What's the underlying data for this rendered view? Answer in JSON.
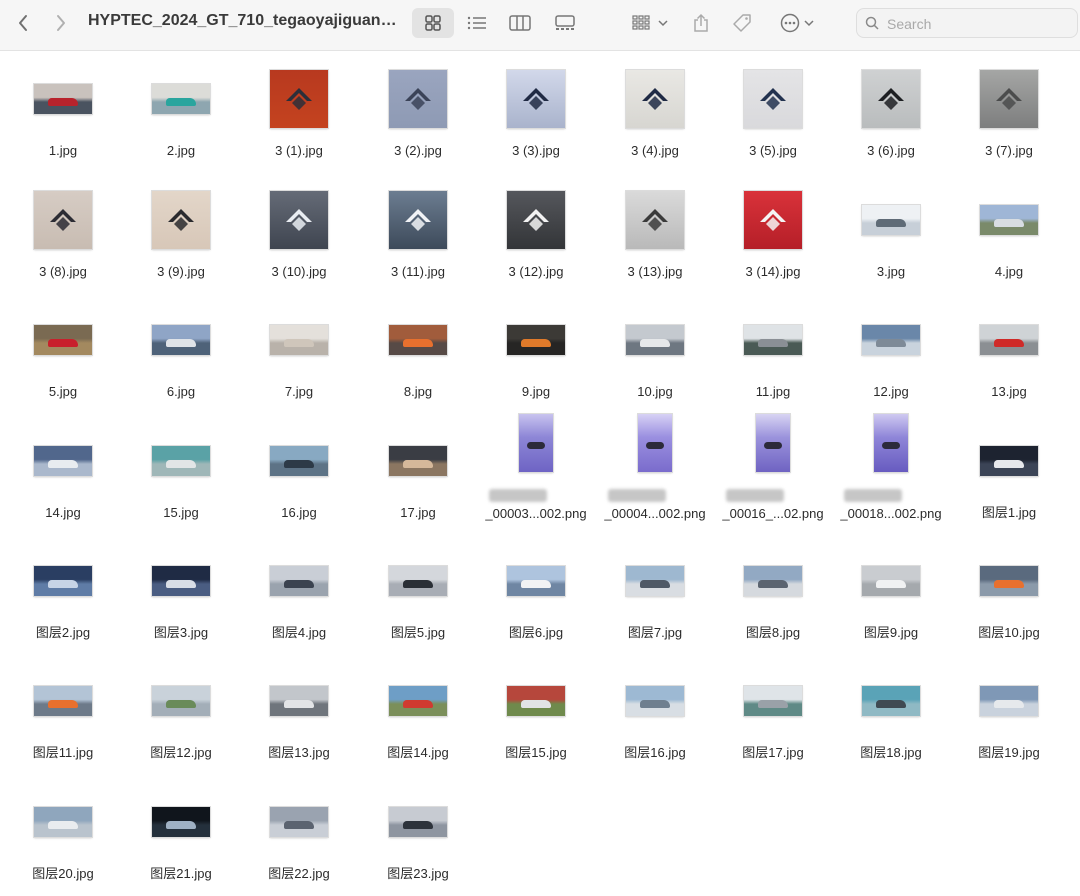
{
  "window": {
    "title": "HYPTEC_2024_GT_710_tegaoyajiguan…",
    "back_icon": "chevron-left-icon",
    "forward_icon": "chevron-right-icon"
  },
  "toolbar": {
    "view_modes": [
      "icon-view-icon",
      "list-view-icon",
      "column-view-icon",
      "gallery-view-icon"
    ],
    "selected_view": "icon-view-icon",
    "group_icon": "group-by-icon",
    "share_icon": "share-icon",
    "tag_icon": "tag-icon",
    "more_icon": "ellipsis-circle-icon"
  },
  "search": {
    "placeholder": "Search",
    "value": ""
  },
  "files": [
    {
      "name": "1.jpg",
      "kind": "landscape",
      "colors": [
        "#c9c2bd",
        "#4a5360",
        "#b8232c"
      ]
    },
    {
      "name": "2.jpg",
      "kind": "landscape",
      "colors": [
        "#dcdcd8",
        "#8ea6b0",
        "#2aa59e"
      ]
    },
    {
      "name": "3 (1).jpg",
      "kind": "square",
      "colors": [
        "#b8391f",
        "#c4431f",
        "#2b2f3a"
      ]
    },
    {
      "name": "3 (2).jpg",
      "kind": "square",
      "colors": [
        "#9aa5bf",
        "#8e9ab4",
        "#3b4358"
      ]
    },
    {
      "name": "3 (3).jpg",
      "kind": "square",
      "colors": [
        "#d2d8ea",
        "#a9b3cc",
        "#202a44"
      ]
    },
    {
      "name": "3 (4).jpg",
      "kind": "square",
      "colors": [
        "#e9e8e4",
        "#d7d6d1",
        "#1f2a44"
      ]
    },
    {
      "name": "3 (5).jpg",
      "kind": "square",
      "colors": [
        "#e4e4e6",
        "#d9d9dc",
        "#23324f"
      ]
    },
    {
      "name": "3 (6).jpg",
      "kind": "square",
      "colors": [
        "#cfd1d2",
        "#b9bcbd",
        "#1d1f22"
      ]
    },
    {
      "name": "3 (7).jpg",
      "kind": "square",
      "colors": [
        "#a5a6a5",
        "#7d7e7e",
        "#4b4c4c"
      ]
    },
    {
      "name": "3 (8).jpg",
      "kind": "square",
      "colors": [
        "#d6ccc4",
        "#c8bcb2",
        "#2c2c34"
      ]
    },
    {
      "name": "3 (9).jpg",
      "kind": "square",
      "colors": [
        "#e3d6c9",
        "#d7c7b8",
        "#2a2a2e"
      ]
    },
    {
      "name": "3 (10).jpg",
      "kind": "square",
      "colors": [
        "#656b77",
        "#3f4550",
        "#e9edf2"
      ]
    },
    {
      "name": "3 (11).jpg",
      "kind": "square",
      "colors": [
        "#6c7d91",
        "#3d4a5a",
        "#f1f3f6"
      ]
    },
    {
      "name": "3 (12).jpg",
      "kind": "square",
      "colors": [
        "#55575c",
        "#333538",
        "#f2f2f2"
      ]
    },
    {
      "name": "3 (13).jpg",
      "kind": "square",
      "colors": [
        "#dadada",
        "#b9b9b9",
        "#3b3b3b"
      ]
    },
    {
      "name": "3 (14).jpg",
      "kind": "square",
      "colors": [
        "#d9323a",
        "#b51f28",
        "#f4f4f4"
      ]
    },
    {
      "name": "3.jpg",
      "kind": "landscape",
      "colors": [
        "#eef1f4",
        "#c7cfd8",
        "#5f6b77"
      ]
    },
    {
      "name": "4.jpg",
      "kind": "landscape",
      "colors": [
        "#9fb6d6",
        "#7a8a6a",
        "#d8dde2"
      ]
    },
    {
      "name": "5.jpg",
      "kind": "landscape",
      "colors": [
        "#7a6a52",
        "#a3895f",
        "#c8202c"
      ]
    },
    {
      "name": "6.jpg",
      "kind": "landscape",
      "colors": [
        "#8fa5c6",
        "#4e6279",
        "#dfe3e8"
      ]
    },
    {
      "name": "7.jpg",
      "kind": "landscape",
      "colors": [
        "#e4e0db",
        "#b9b2aa",
        "#cfc6bb"
      ]
    },
    {
      "name": "8.jpg",
      "kind": "landscape",
      "colors": [
        "#a15c3c",
        "#574a46",
        "#e8702e"
      ]
    },
    {
      "name": "9.jpg",
      "kind": "landscape",
      "colors": [
        "#3c3a36",
        "#262524",
        "#e07a2a"
      ]
    },
    {
      "name": "10.jpg",
      "kind": "landscape",
      "colors": [
        "#c4c9cf",
        "#6e7781",
        "#e6e8ea"
      ]
    },
    {
      "name": "11.jpg",
      "kind": "landscape",
      "colors": [
        "#dfe3e6",
        "#4a5a55",
        "#8a8f95"
      ]
    },
    {
      "name": "12.jpg",
      "kind": "landscape",
      "colors": [
        "#6a87a9",
        "#c9d3dd",
        "#7e8a97"
      ]
    },
    {
      "name": "13.jpg",
      "kind": "landscape",
      "colors": [
        "#cfd3d6",
        "#8b8f93",
        "#cf2a28"
      ]
    },
    {
      "name": "14.jpg",
      "kind": "landscape",
      "colors": [
        "#51678c",
        "#aab8cc",
        "#e8ecf0"
      ]
    },
    {
      "name": "15.jpg",
      "kind": "landscape",
      "colors": [
        "#5aa2a6",
        "#9fb7b8",
        "#e2e5e6"
      ]
    },
    {
      "name": "16.jpg",
      "kind": "landscape",
      "colors": [
        "#88a9c2",
        "#5d7386",
        "#2d3a47"
      ]
    },
    {
      "name": "17.jpg",
      "kind": "landscape",
      "colors": [
        "#3a3d44",
        "#8b7661",
        "#d5b89a"
      ]
    },
    {
      "name": "___空间_00003...002.png",
      "line2": "_00003...002.png",
      "kind": "portrait",
      "colors": [
        "#8d86d6",
        "#6e64c4",
        "#c8c3ef"
      ]
    },
    {
      "name": "___空间_00004...002.png",
      "line2": "_00004...002.png",
      "kind": "portrait",
      "colors": [
        "#9a8fe0",
        "#7a6ccc",
        "#d7d1f5"
      ]
    },
    {
      "name": "____01_00016_...02.png",
      "line2": "_00016_...02.png",
      "kind": "portrait",
      "colors": [
        "#9b93dc",
        "#6f63c2",
        "#d8d4f3"
      ]
    },
    {
      "name": "___空间_00018...002.png",
      "line2": "_00018...002.png",
      "kind": "portrait",
      "colors": [
        "#8f86d8",
        "#675bc0",
        "#cfc9f1"
      ]
    },
    {
      "name": "图层1.jpg",
      "kind": "landscape",
      "colors": [
        "#1d2330",
        "#3b4456",
        "#e6e8ec"
      ]
    },
    {
      "name": "图层2.jpg",
      "kind": "landscape",
      "colors": [
        "#2a3e62",
        "#5f7ca6",
        "#c7d4e6"
      ]
    },
    {
      "name": "图层3.jpg",
      "kind": "landscape",
      "colors": [
        "#1f2b44",
        "#4a5d82",
        "#d8dde6"
      ]
    },
    {
      "name": "图层4.jpg",
      "kind": "landscape",
      "colors": [
        "#c9ced6",
        "#9aa3ae",
        "#3b4350"
      ]
    },
    {
      "name": "图层5.jpg",
      "kind": "landscape",
      "colors": [
        "#d4d7dc",
        "#a8adb5",
        "#2a2f36"
      ]
    },
    {
      "name": "图层6.jpg",
      "kind": "landscape",
      "colors": [
        "#aec4de",
        "#6f86a3",
        "#f1f2f4"
      ]
    },
    {
      "name": "图层7.jpg",
      "kind": "landscape",
      "colors": [
        "#9eb8d0",
        "#d9dde2",
        "#4f5966"
      ]
    },
    {
      "name": "图层8.jpg",
      "kind": "landscape",
      "colors": [
        "#92a9c3",
        "#d5d9de",
        "#5b6470"
      ]
    },
    {
      "name": "图层9.jpg",
      "kind": "landscape",
      "colors": [
        "#c9ccd0",
        "#a5a9ad",
        "#f0f1f2"
      ]
    },
    {
      "name": "图层10.jpg",
      "kind": "landscape",
      "colors": [
        "#5a6a7e",
        "#8b9aaa",
        "#e8702e"
      ]
    },
    {
      "name": "图层11.jpg",
      "kind": "landscape",
      "colors": [
        "#b3c4d6",
        "#6d7a89",
        "#e8702e"
      ]
    },
    {
      "name": "图层12.jpg",
      "kind": "landscape",
      "colors": [
        "#c9d2da",
        "#a3aeb8",
        "#6a8b5a"
      ]
    },
    {
      "name": "图层13.jpg",
      "kind": "landscape",
      "colors": [
        "#c2c6cb",
        "#6f757c",
        "#e2e4e6"
      ]
    },
    {
      "name": "图层14.jpg",
      "kind": "landscape",
      "colors": [
        "#6e9ec6",
        "#7b8f5a",
        "#d03a30"
      ]
    },
    {
      "name": "图层15.jpg",
      "kind": "landscape",
      "colors": [
        "#b6473c",
        "#6f8a4c",
        "#e1e3e5"
      ]
    },
    {
      "name": "图层16.jpg",
      "kind": "landscape",
      "colors": [
        "#9db9d3",
        "#d8dee4",
        "#6f7f8f"
      ]
    },
    {
      "name": "图层17.jpg",
      "kind": "landscape",
      "colors": [
        "#dfe4e8",
        "#5f8a86",
        "#9aa1a8"
      ]
    },
    {
      "name": "图层18.jpg",
      "kind": "landscape",
      "colors": [
        "#5aa3b7",
        "#8fb9c4",
        "#3f4a52"
      ]
    },
    {
      "name": "图层19.jpg",
      "kind": "landscape",
      "colors": [
        "#7f98b6",
        "#c9d2dd",
        "#e6e9ec"
      ]
    },
    {
      "name": "图层20.jpg",
      "kind": "landscape",
      "colors": [
        "#8fa6bd",
        "#b9c3cd",
        "#e9ecef"
      ]
    },
    {
      "name": "图层21.jpg",
      "kind": "landscape",
      "colors": [
        "#10151c",
        "#24303c",
        "#9fb1c4"
      ]
    },
    {
      "name": "图层22.jpg",
      "kind": "landscape",
      "colors": [
        "#9aa3b0",
        "#c9ced6",
        "#5b6370"
      ]
    },
    {
      "name": "图层23.jpg",
      "kind": "landscape",
      "colors": [
        "#c7cbd2",
        "#8e95a0",
        "#2d333b"
      ]
    }
  ]
}
